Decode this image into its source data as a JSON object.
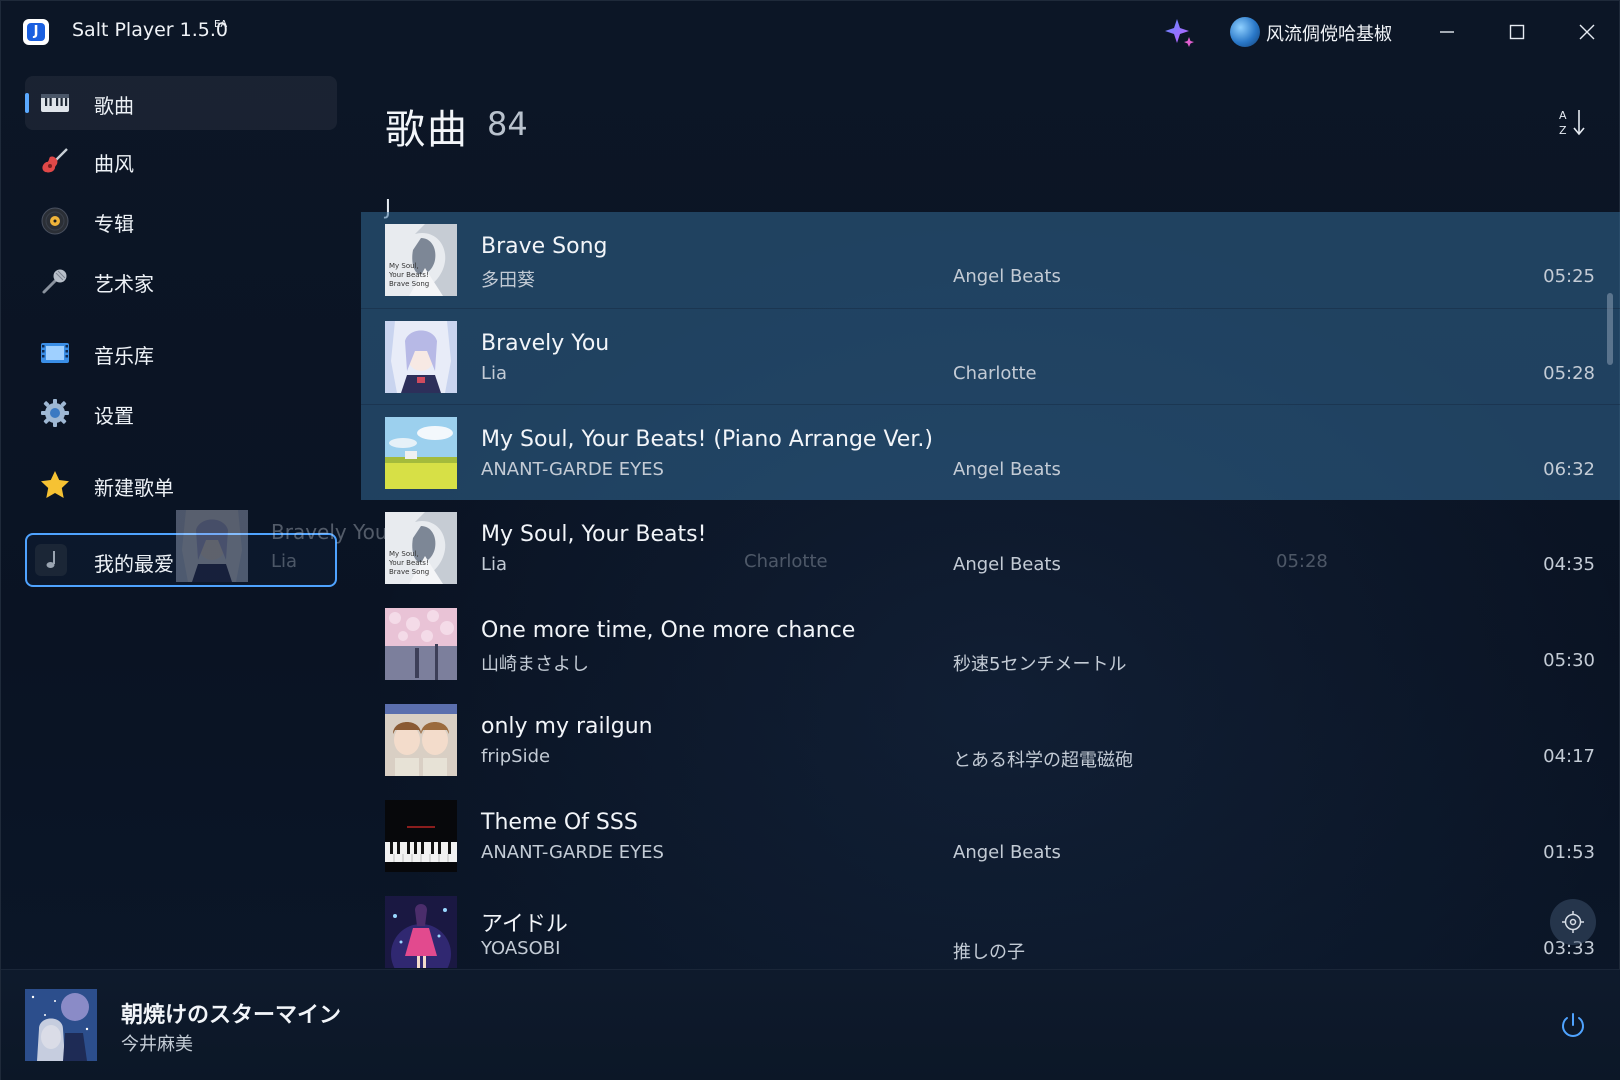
{
  "titlebar": {
    "app_name": "Salt Player 1.5.0",
    "app_badge": "EA",
    "user_name": "风流倜傥哈基椒"
  },
  "sidebar": {
    "items": [
      {
        "label": "歌曲",
        "icon": "piano-keys-icon",
        "active": true
      },
      {
        "label": "曲风",
        "icon": "guitar-icon"
      },
      {
        "label": "专辑",
        "icon": "vinyl-disc-icon"
      },
      {
        "label": "艺术家",
        "icon": "microphone-icon"
      },
      {
        "label": "音乐库",
        "icon": "film-strip-icon"
      },
      {
        "label": "设置",
        "icon": "gear-icon"
      },
      {
        "label": "新建歌单",
        "icon": "star-icon"
      }
    ],
    "playlist": {
      "label": "我的最爱",
      "icon": "music-note-icon"
    }
  },
  "drag_ghost": {
    "title": "Bravely You",
    "artist": "Lia",
    "album": "Charlotte",
    "duration": "05:28"
  },
  "main": {
    "title": "歌曲",
    "count": "84",
    "section_letter": "J",
    "songs": [
      {
        "title": "Brave Song",
        "artist": "多田葵",
        "album": "Angel Beats",
        "duration": "05:25",
        "selected": true
      },
      {
        "title": "Bravely You",
        "artist": "Lia",
        "album": "Charlotte",
        "duration": "05:28",
        "selected": true
      },
      {
        "title": "My Soul, Your Beats! (Piano Arrange Ver.)",
        "artist": "ANANT-GARDE EYES",
        "album": "Angel Beats",
        "duration": "06:32",
        "selected": true
      },
      {
        "title": "My Soul, Your Beats!",
        "artist": "Lia",
        "album": "Angel Beats",
        "duration": "04:35"
      },
      {
        "title": "One more time, One more chance",
        "artist": "山崎まさよし",
        "album": "秒速5センチメートル",
        "duration": "05:30"
      },
      {
        "title": "only my railgun",
        "artist": "fripSide",
        "album": "とある科学の超電磁砲",
        "duration": "04:17"
      },
      {
        "title": "Theme Of SSS",
        "artist": "ANANT-GARDE EYES",
        "album": "Angel Beats",
        "duration": "01:53"
      },
      {
        "title": "アイドル",
        "artist": "YOASOBI",
        "album": "推しの子",
        "duration": "03:33"
      }
    ]
  },
  "player": {
    "title": "朝焼けのスターマイン",
    "artist": "今井麻美"
  },
  "colors": {
    "accent": "#4fa3ff",
    "selection": "#2f6a96",
    "background": "#0a1424"
  }
}
